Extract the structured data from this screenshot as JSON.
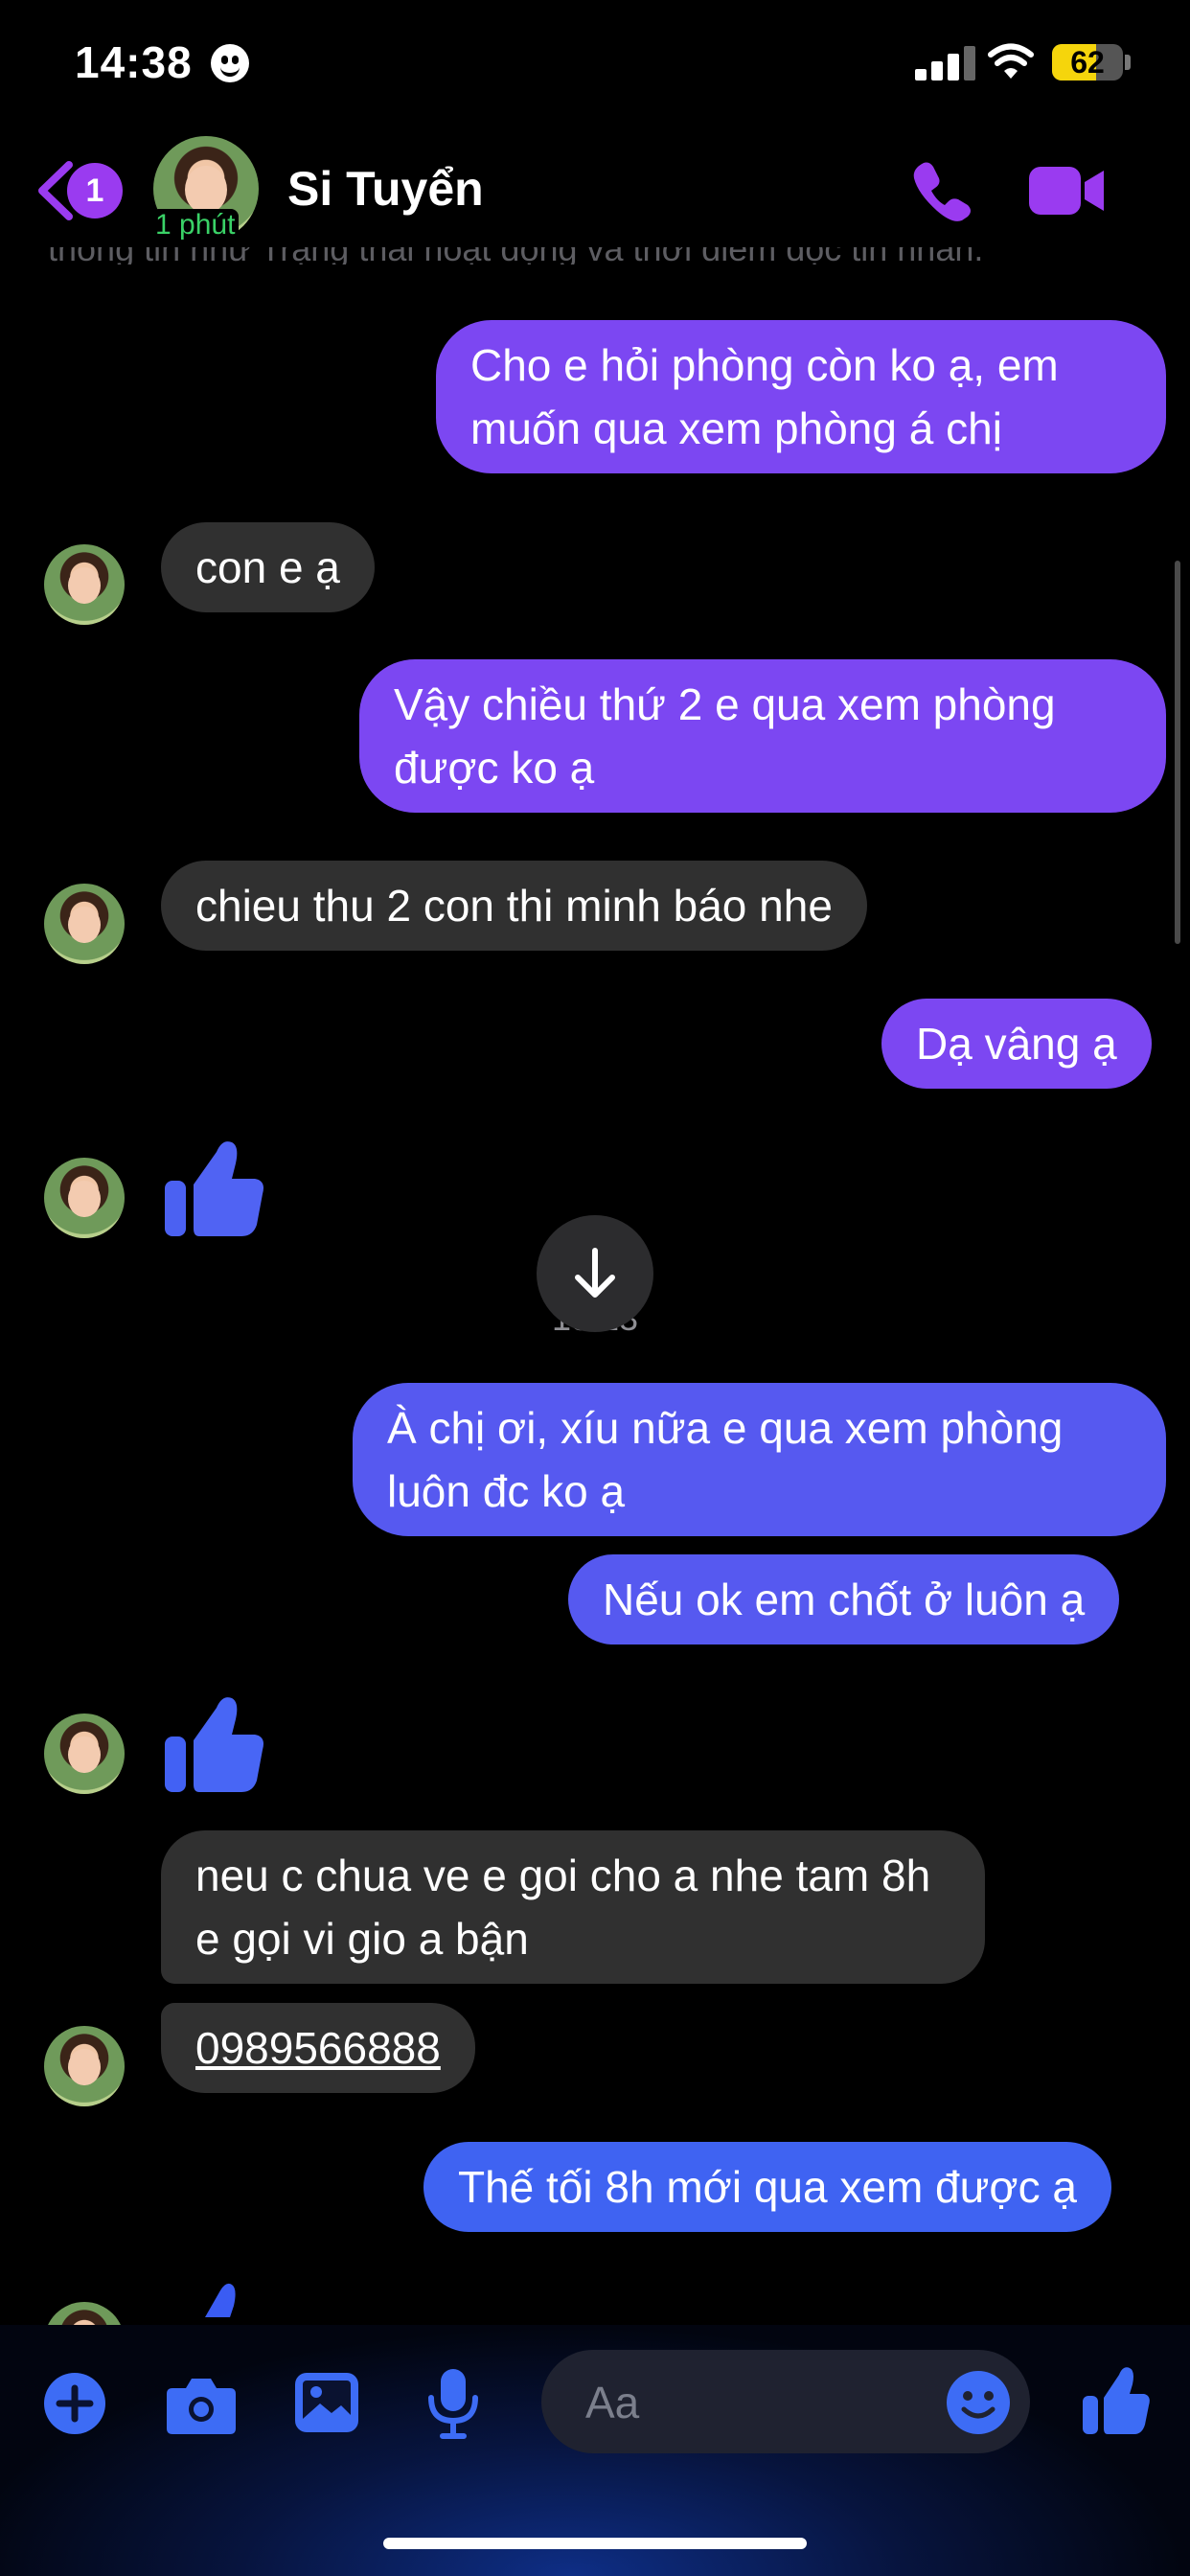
{
  "status_bar": {
    "time": "14:38",
    "battery": "62",
    "battery_level": 0.62
  },
  "header": {
    "back_count": "1",
    "active_time": "1 phút",
    "contact_name": "Si Tuyển",
    "faded_notice": "thông tin như Trạng thái hoạt động và thời điểm đọc tin nhắn."
  },
  "messages": [
    {
      "id": "m1",
      "dir": "out",
      "text": "Cho e hỏi phòng còn ko ạ, em muốn qua xem phòng á chị"
    },
    {
      "id": "m2",
      "dir": "in",
      "text": "con e ạ"
    },
    {
      "id": "m3",
      "dir": "out",
      "text": "Vậy chiều thứ 2 e qua xem phòng được ko ạ"
    },
    {
      "id": "m4",
      "dir": "in",
      "text": "chieu thu 2 con thi minh báo nhe"
    },
    {
      "id": "m5",
      "dir": "out",
      "text": "Dạ vâng ạ"
    },
    {
      "id": "m6",
      "dir": "in",
      "sticker": "thumbs-up"
    },
    {
      "id": "m7",
      "dir": "out",
      "text": "À chị ơi, xíu nữa e qua xem phòng luôn đc ko ạ"
    },
    {
      "id": "m8",
      "dir": "out",
      "text": "Nếu ok em chốt ở luôn ạ"
    },
    {
      "id": "m9",
      "dir": "in",
      "sticker": "thumbs-up"
    },
    {
      "id": "m10",
      "dir": "in",
      "text": "neu c chua ve e goi cho a nhe tam 8h e gọi vi gio a bận"
    },
    {
      "id": "m11",
      "dir": "in",
      "text": "0989566888",
      "link": true
    },
    {
      "id": "m12",
      "dir": "out",
      "text": "Thế tối 8h mới qua xem được ạ"
    }
  ],
  "timestamp": "13:13",
  "composer": {
    "placeholder": "Aa"
  },
  "colors": {
    "accent": "#9a3bf0",
    "bubble_out_1": "#7c47f2",
    "bubble_out_2": "#5659f0",
    "bubble_out_3": "#3f63f2",
    "bubble_in": "#303030",
    "icon_blue": "#3d6cf5",
    "active_green": "#3ad267"
  },
  "icons": [
    "back-chevron-icon",
    "phone-icon",
    "video-camera-icon",
    "thumbs-up-icon",
    "scroll-down-arrow-icon",
    "plus-icon",
    "camera-icon",
    "image-icon",
    "microphone-icon",
    "emoji-icon",
    "like-icon"
  ]
}
